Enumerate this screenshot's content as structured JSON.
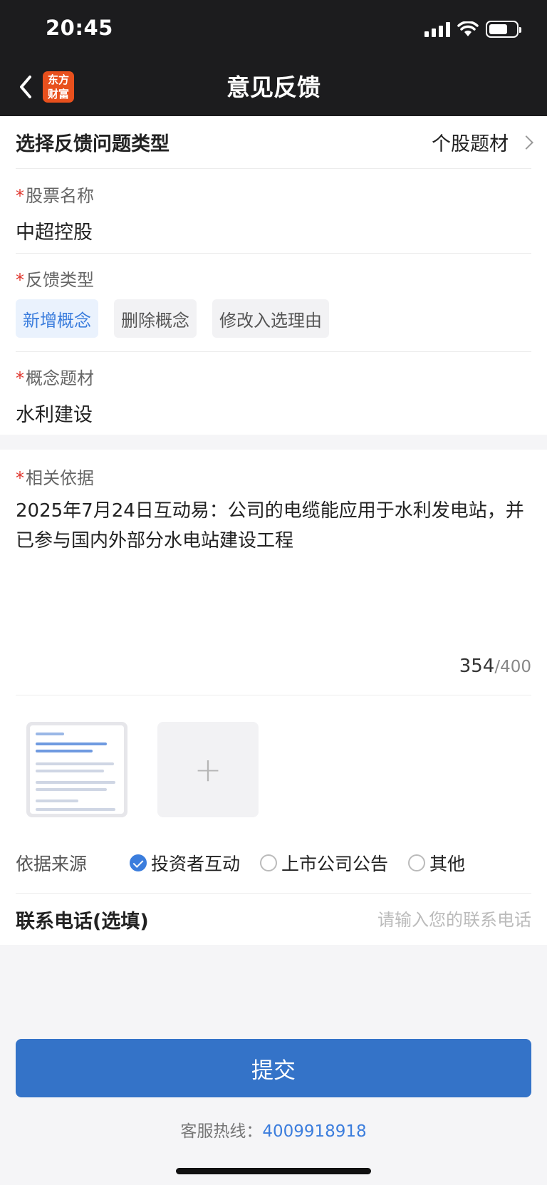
{
  "status_bar": {
    "time": "20:45"
  },
  "nav": {
    "title": "意见反馈",
    "logo_line1": "东方",
    "logo_line2": "财富"
  },
  "type_row": {
    "label": "选择反馈问题类型",
    "value": "个股题材"
  },
  "stock": {
    "label": "股票名称",
    "value": "中超控股"
  },
  "feedback_type": {
    "label": "反馈类型",
    "options": [
      "新增概念",
      "删除概念",
      "修改入选理由"
    ],
    "selected": "新增概念"
  },
  "concept": {
    "label": "概念题材",
    "value": "水利建设"
  },
  "basis": {
    "label": "相关依据",
    "text": "2025年7月24日互动易：公司的电缆能应用于水利发电站，并已参与国内外部分水电站建设工程",
    "count": "354",
    "max": "/400"
  },
  "upload": {
    "add_symbol": "+"
  },
  "source": {
    "label": "依据来源",
    "options": [
      "投资者互动",
      "上市公司公告",
      "其他"
    ],
    "selected": "投资者互动"
  },
  "phone": {
    "label": "联系电话(选填)",
    "placeholder": "请输入您的联系电话"
  },
  "submit_label": "提交",
  "hotline": {
    "label": "客服热线：",
    "number": "4009918918"
  },
  "colors": {
    "accent": "#3473c8",
    "required": "#e0362e",
    "brand": "#e8501d"
  }
}
